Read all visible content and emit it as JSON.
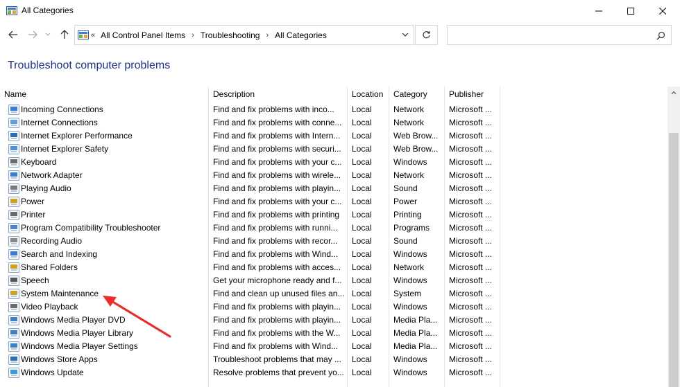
{
  "window": {
    "title": "All Categories",
    "controls": {
      "minimize": "minimize-icon",
      "maximize": "maximize-icon",
      "close": "close-icon"
    }
  },
  "nav": {
    "back": "back-arrow-icon",
    "forward": "forward-arrow-icon",
    "recent": "chevron-down-icon",
    "up": "up-arrow-icon"
  },
  "address": {
    "lead": "«",
    "crumbs": [
      "All Control Panel Items",
      "Troubleshooting",
      "All Categories"
    ],
    "separator": "›"
  },
  "search": {
    "placeholder": ""
  },
  "heading": "Troubleshoot computer problems",
  "columns": [
    "Name",
    "Description",
    "Location",
    "Category",
    "Publisher"
  ],
  "rows": [
    {
      "name": "Incoming Connections",
      "description": "Find and fix problems with inco...",
      "location": "Local",
      "category": "Network",
      "publisher": "Microsoft ...",
      "icon": "incoming-connections-icon"
    },
    {
      "name": "Internet Connections",
      "description": "Find and fix problems with conne...",
      "location": "Local",
      "category": "Network",
      "publisher": "Microsoft ...",
      "icon": "internet-connections-icon"
    },
    {
      "name": "Internet Explorer Performance",
      "description": "Find and fix problems with Intern...",
      "location": "Local",
      "category": "Web Brow...",
      "publisher": "Microsoft ...",
      "icon": "ie-performance-icon"
    },
    {
      "name": "Internet Explorer Safety",
      "description": "Find and fix problems with securi...",
      "location": "Local",
      "category": "Web Brow...",
      "publisher": "Microsoft ...",
      "icon": "ie-safety-icon"
    },
    {
      "name": "Keyboard",
      "description": "Find and fix problems with your c...",
      "location": "Local",
      "category": "Windows",
      "publisher": "Microsoft ...",
      "icon": "keyboard-icon"
    },
    {
      "name": "Network Adapter",
      "description": "Find and fix problems with wirele...",
      "location": "Local",
      "category": "Network",
      "publisher": "Microsoft ...",
      "icon": "network-adapter-icon"
    },
    {
      "name": "Playing Audio",
      "description": "Find and fix problems with playin...",
      "location": "Local",
      "category": "Sound",
      "publisher": "Microsoft ...",
      "icon": "playing-audio-icon"
    },
    {
      "name": "Power",
      "description": "Find and fix problems with your c...",
      "location": "Local",
      "category": "Power",
      "publisher": "Microsoft ...",
      "icon": "power-icon"
    },
    {
      "name": "Printer",
      "description": "Find and fix problems with printing",
      "location": "Local",
      "category": "Printing",
      "publisher": "Microsoft ...",
      "icon": "printer-icon"
    },
    {
      "name": "Program Compatibility Troubleshooter",
      "description": "Find and fix problems with runni...",
      "location": "Local",
      "category": "Programs",
      "publisher": "Microsoft ...",
      "icon": "program-compat-icon"
    },
    {
      "name": "Recording Audio",
      "description": "Find and fix problems with recor...",
      "location": "Local",
      "category": "Sound",
      "publisher": "Microsoft ...",
      "icon": "recording-audio-icon"
    },
    {
      "name": "Search and Indexing",
      "description": "Find and fix problems with Wind...",
      "location": "Local",
      "category": "Windows",
      "publisher": "Microsoft ...",
      "icon": "search-indexing-icon"
    },
    {
      "name": "Shared Folders",
      "description": "Find and fix problems with acces...",
      "location": "Local",
      "category": "Network",
      "publisher": "Microsoft ...",
      "icon": "shared-folders-icon"
    },
    {
      "name": "Speech",
      "description": "Get your microphone ready and f...",
      "location": "Local",
      "category": "Windows",
      "publisher": "Microsoft ...",
      "icon": "speech-icon"
    },
    {
      "name": "System Maintenance",
      "description": "Find and clean up unused files an...",
      "location": "Local",
      "category": "System",
      "publisher": "Microsoft ...",
      "icon": "system-maintenance-icon"
    },
    {
      "name": "Video Playback",
      "description": "Find and fix problems with playin...",
      "location": "Local",
      "category": "Windows",
      "publisher": "Microsoft ...",
      "icon": "video-playback-icon"
    },
    {
      "name": "Windows Media Player DVD",
      "description": "Find and fix problems with playin...",
      "location": "Local",
      "category": "Media Pla...",
      "publisher": "Microsoft ...",
      "icon": "wmp-dvd-icon"
    },
    {
      "name": "Windows Media Player Library",
      "description": "Find and fix problems with the W...",
      "location": "Local",
      "category": "Media Pla...",
      "publisher": "Microsoft ...",
      "icon": "wmp-library-icon"
    },
    {
      "name": "Windows Media Player Settings",
      "description": "Find and fix problems with Wind...",
      "location": "Local",
      "category": "Media Pla...",
      "publisher": "Microsoft ...",
      "icon": "wmp-settings-icon"
    },
    {
      "name": "Windows Store Apps",
      "description": "Troubleshoot problems that may ...",
      "location": "Local",
      "category": "Windows",
      "publisher": "Microsoft ...",
      "icon": "store-apps-icon"
    },
    {
      "name": "Windows Update",
      "description": "Resolve problems that prevent yo...",
      "location": "Local",
      "category": "Windows",
      "publisher": "Microsoft ...",
      "icon": "windows-update-icon"
    }
  ],
  "colors": {
    "heading": "#1e3287",
    "annotation_arrow": "#e8302a",
    "border": "#d9d9d9",
    "column_separator": "#e5e5e5",
    "scroll_thumb": "#cdcdcd"
  }
}
